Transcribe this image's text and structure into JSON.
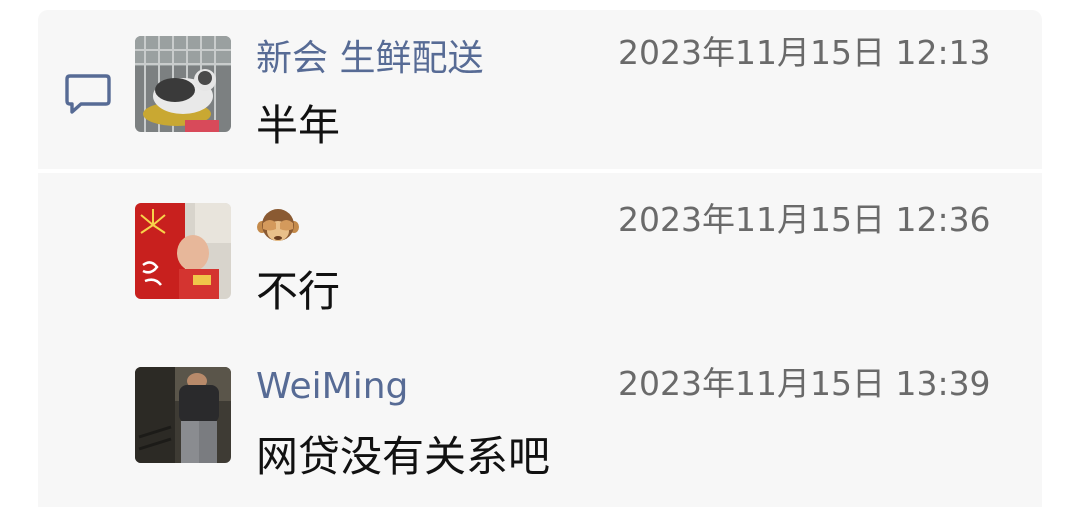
{
  "comments": [
    {
      "author": "新会 生鲜配送",
      "timestamp": "2023年11月15日 12:13",
      "text": "半年"
    },
    {
      "author_icon": "see-no-evil-monkey-emoji",
      "timestamp": "2023年11月15日 12:36",
      "text": "不行"
    },
    {
      "author": "WeiMing",
      "timestamp": "2023年11月15日 13:39",
      "text": "网贷没有关系吧"
    }
  ],
  "colors": {
    "author_name": "#576b95",
    "timestamp": "#6a6a6a",
    "panel_bg": "#f7f7f7"
  },
  "icons": {
    "section": "comment-icon"
  }
}
